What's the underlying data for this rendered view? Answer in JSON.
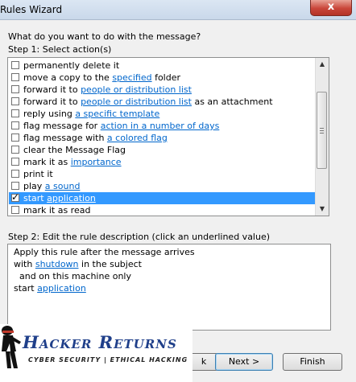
{
  "window": {
    "title": "Rules Wizard",
    "close_glyph": "x"
  },
  "prompt": "What do you want to do with the message?",
  "step1": {
    "label": "Step 1: Select action(s)",
    "items": [
      {
        "before": "permanently delete it",
        "link": "",
        "after": "",
        "checked": false,
        "selected": false
      },
      {
        "before": "move a copy to the ",
        "link": "specified",
        "after": " folder",
        "checked": false,
        "selected": false
      },
      {
        "before": "forward it to ",
        "link": "people or distribution list",
        "after": "",
        "checked": false,
        "selected": false
      },
      {
        "before": "forward it to ",
        "link": "people or distribution list",
        "after": " as an attachment",
        "checked": false,
        "selected": false
      },
      {
        "before": "reply using ",
        "link": "a specific template",
        "after": "",
        "checked": false,
        "selected": false
      },
      {
        "before": "flag message for ",
        "link": "action in a number of days",
        "after": "",
        "checked": false,
        "selected": false
      },
      {
        "before": "flag message with ",
        "link": "a colored flag",
        "after": "",
        "checked": false,
        "selected": false
      },
      {
        "before": "clear the Message Flag",
        "link": "",
        "after": "",
        "checked": false,
        "selected": false
      },
      {
        "before": "mark it as ",
        "link": "importance",
        "after": "",
        "checked": false,
        "selected": false
      },
      {
        "before": "print it",
        "link": "",
        "after": "",
        "checked": false,
        "selected": false
      },
      {
        "before": "play ",
        "link": "a sound",
        "after": "",
        "checked": false,
        "selected": false
      },
      {
        "before": "start ",
        "link": "application",
        "after": "",
        "checked": true,
        "selected": true
      },
      {
        "before": "mark it as read",
        "link": "",
        "after": "",
        "checked": false,
        "selected": false
      }
    ]
  },
  "step2": {
    "label": "Step 2: Edit the rule description (click an underlined value)",
    "lines": [
      {
        "before": "Apply this rule after the message arrives",
        "link": "",
        "after": ""
      },
      {
        "before": "with ",
        "link": "shutdown",
        "after": " in the subject"
      },
      {
        "before": "  and on this machine only",
        "link": "",
        "after": ""
      },
      {
        "before": "start ",
        "link": "application",
        "after": ""
      }
    ]
  },
  "buttons": {
    "back_label": "k",
    "next_label": "Next >",
    "finish_label": "Finish"
  },
  "overlay_logo": {
    "title": "Hacker Returns",
    "subtitle": "Cyber Security | Ethical Hacking"
  }
}
